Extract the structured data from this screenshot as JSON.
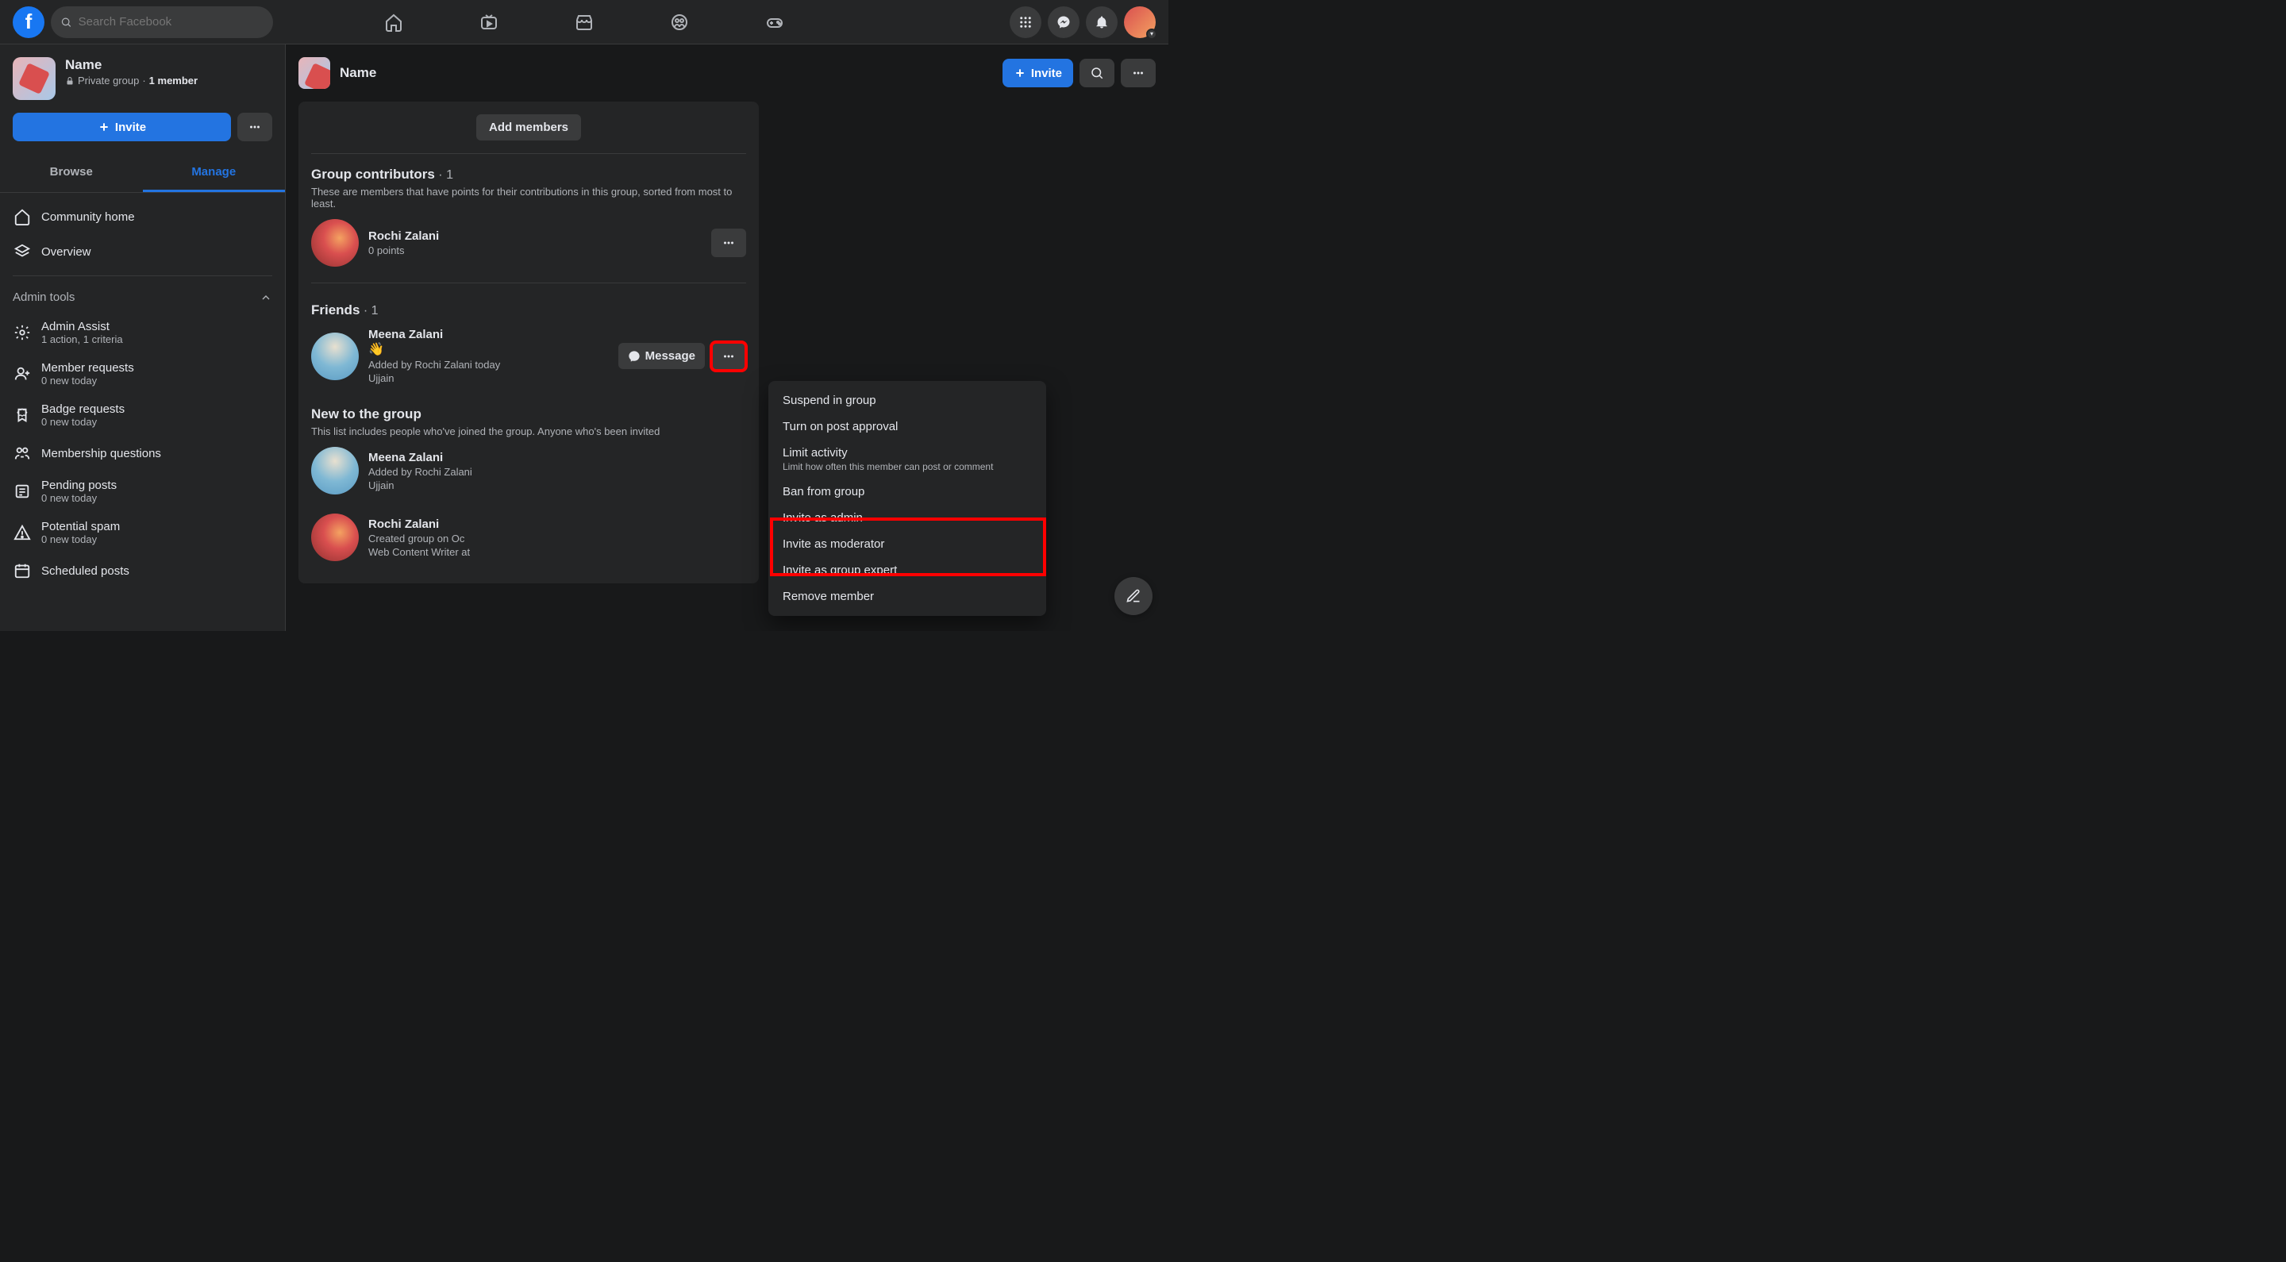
{
  "topnav": {
    "search_placeholder": "Search Facebook"
  },
  "sidebar": {
    "group_name": "Name",
    "privacy": "Private group",
    "member_count": "1 member",
    "invite_label": "Invite",
    "tabs": {
      "browse": "Browse",
      "manage": "Manage"
    },
    "community_home": "Community home",
    "overview": "Overview",
    "admin_tools": "Admin tools",
    "admin_assist": {
      "label": "Admin Assist",
      "sub": "1 action, 1 criteria"
    },
    "member_requests": {
      "label": "Member requests",
      "sub": "0 new today"
    },
    "badge_requests": {
      "label": "Badge requests",
      "sub": "0 new today"
    },
    "membership_questions": "Membership questions",
    "pending_posts": {
      "label": "Pending posts",
      "sub": "0 new today"
    },
    "potential_spam": {
      "label": "Potential spam",
      "sub": "0 new today"
    },
    "scheduled_posts": "Scheduled posts"
  },
  "main": {
    "title": "Name",
    "invite_label": "Invite",
    "add_members": "Add members",
    "contributors": {
      "title": "Group contributors",
      "count": "1",
      "desc": "These are members that have points for their contributions in this group, sorted from most to least.",
      "member": {
        "name": "Rochi Zalani",
        "sub": "0 points"
      }
    },
    "friends": {
      "title": "Friends",
      "count": "1",
      "member": {
        "name": "Meena Zalani",
        "added": "Added by Rochi Zalani today",
        "location": "Ujjain",
        "message_label": "Message"
      }
    },
    "new_to_group": {
      "title": "New to the group",
      "desc": "This list includes people who've joined the group. Anyone who's been invited",
      "members": [
        {
          "name": "Meena Zalani",
          "line1": "Added by Rochi Zalani",
          "line2": "Ujjain"
        },
        {
          "name": "Rochi Zalani",
          "line1": "Created group on Oc",
          "line2": "Web Content Writer at"
        }
      ]
    }
  },
  "context_menu": {
    "suspend": "Suspend in group",
    "post_approval": "Turn on post approval",
    "limit_activity": "Limit activity",
    "limit_activity_sub": "Limit how often this member can post or comment",
    "ban": "Ban from group",
    "invite_admin": "Invite as admin",
    "invite_moderator": "Invite as moderator",
    "invite_expert": "Invite as group expert",
    "remove": "Remove member"
  }
}
